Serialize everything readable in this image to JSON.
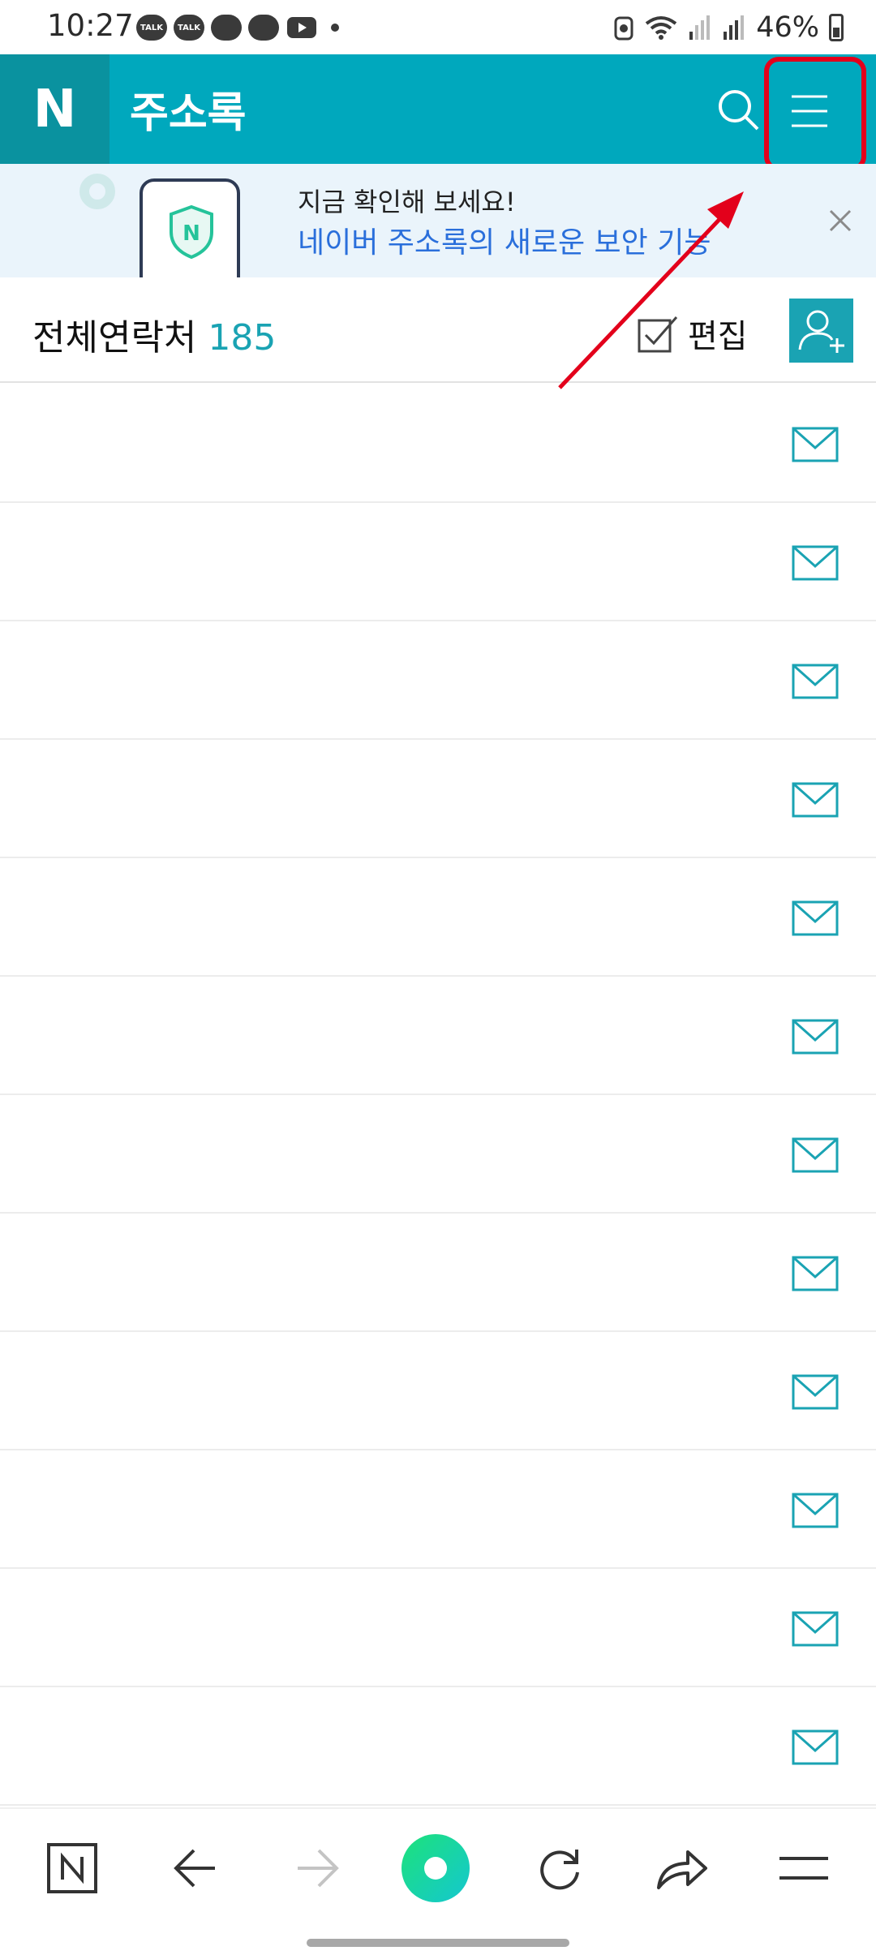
{
  "status_bar": {
    "time": "10:27",
    "notifications": [
      "TALK",
      "TALK",
      "",
      ""
    ],
    "battery": "46%"
  },
  "header": {
    "logo": "N",
    "title": "주소록",
    "accent_color": "#00a8bd",
    "search_icon": "search-icon",
    "menu_icon": "hamburger-menu-icon"
  },
  "banner": {
    "line1": "지금 확인해 보세요!",
    "line2": "네이버 주소록의 새로운 보안 기능",
    "close_icon": "close-icon"
  },
  "summary": {
    "label": "전체연락처",
    "count": "185",
    "edit_label": "편집"
  },
  "contacts_count_visible": 12,
  "bottom_bar": {
    "items": [
      "naver-home-icon",
      "back-icon",
      "forward-icon",
      "green-dot-icon",
      "refresh-icon",
      "share-icon",
      "menu-icon"
    ]
  },
  "annotation": {
    "highlight_color": "#e3001b"
  }
}
